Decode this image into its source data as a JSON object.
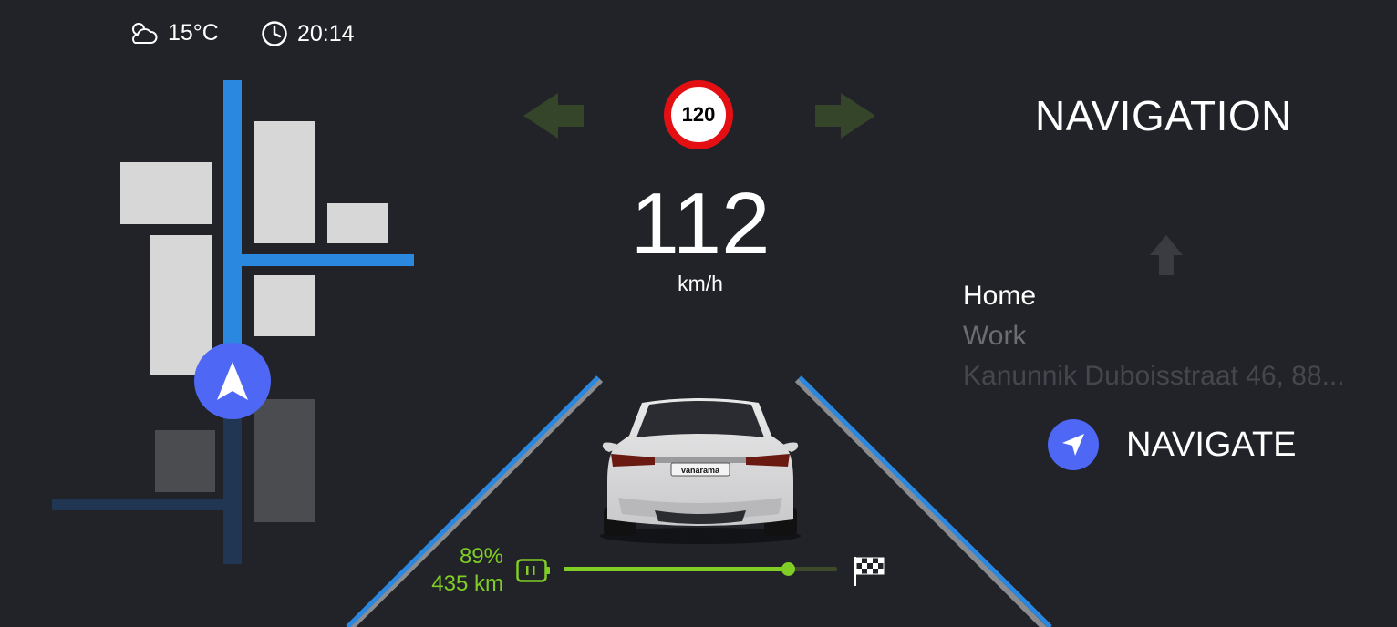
{
  "status": {
    "temperature": "15°C",
    "time": "20:14",
    "weather_icon": "partly-cloudy-icon",
    "clock_icon": "clock-icon"
  },
  "speed": {
    "limit": "120",
    "value": "112",
    "unit": "km/h"
  },
  "navigation": {
    "title": "NAVIGATION",
    "destinations": [
      "Home",
      "Work",
      "Kanunnik Duboisstraat 46, 88..."
    ],
    "selected_index": 0,
    "navigate_label": "NAVIGATE"
  },
  "battery": {
    "percent_label": "89%",
    "range_label": "435 km",
    "trip_progress": 0.82
  },
  "colors": {
    "background": "#212329",
    "road_blue": "#2a88e0",
    "accent_green": "#7fcd25",
    "limit_red": "#e30f13",
    "nav_blue": "#4f67f5",
    "turn_arrow": "#34452a"
  },
  "car": {
    "plate": "vanarama"
  }
}
